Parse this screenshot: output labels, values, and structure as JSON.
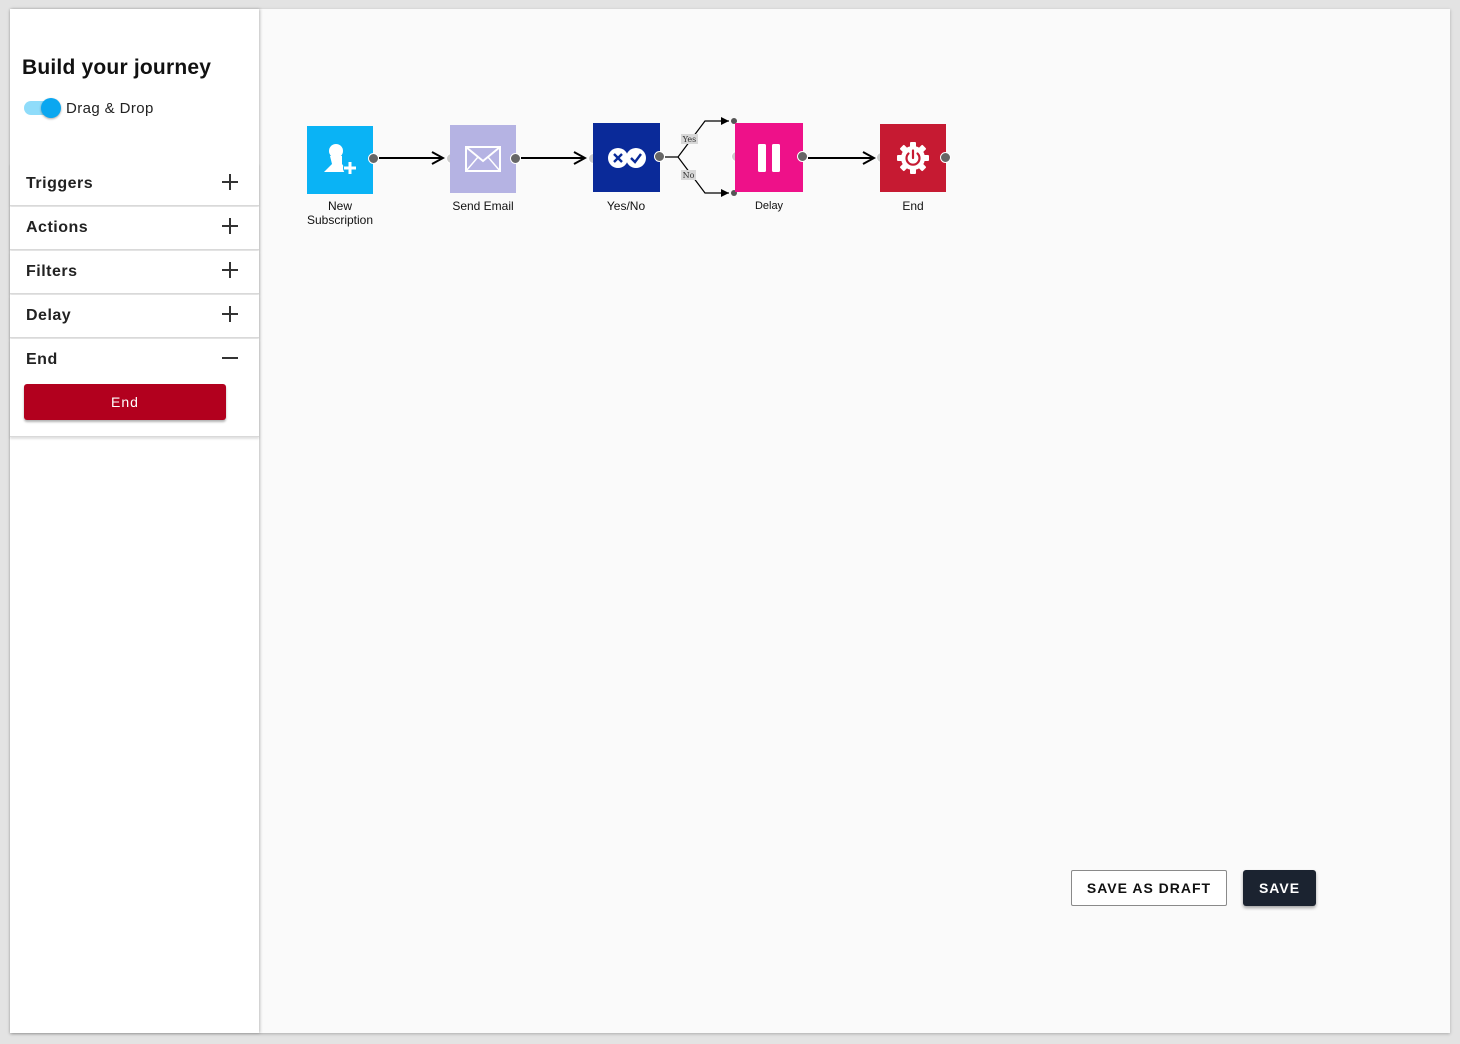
{
  "sidebar": {
    "title": "Build your journey",
    "toggle_label": "Drag & Drop",
    "toggle_on": true,
    "sections": [
      {
        "label": "Triggers",
        "expanded": false
      },
      {
        "label": "Actions",
        "expanded": false
      },
      {
        "label": "Filters",
        "expanded": false
      },
      {
        "label": "Delay",
        "expanded": false
      },
      {
        "label": "End",
        "expanded": true
      }
    ],
    "end_button_label": "End"
  },
  "flow": {
    "nodes": [
      {
        "label_line1": "New",
        "label_line2": "Subscription",
        "icon": "user-add-icon",
        "color": "#0ab3f5"
      },
      {
        "label": "Send Email",
        "icon": "envelope-icon",
        "color": "#b5b3e3"
      },
      {
        "label": "Yes/No",
        "icon": "yes-no-icon",
        "color": "#0a2a99"
      },
      {
        "label": "Delay",
        "icon": "pause-icon",
        "color": "#ee1189"
      },
      {
        "label": "End",
        "icon": "power-gear-icon",
        "color": "#c61a32"
      }
    ],
    "branch_yes": "Yes",
    "branch_no": "No"
  },
  "footer": {
    "save_draft_label": "SAVE AS DRAFT",
    "save_label": "SAVE"
  }
}
